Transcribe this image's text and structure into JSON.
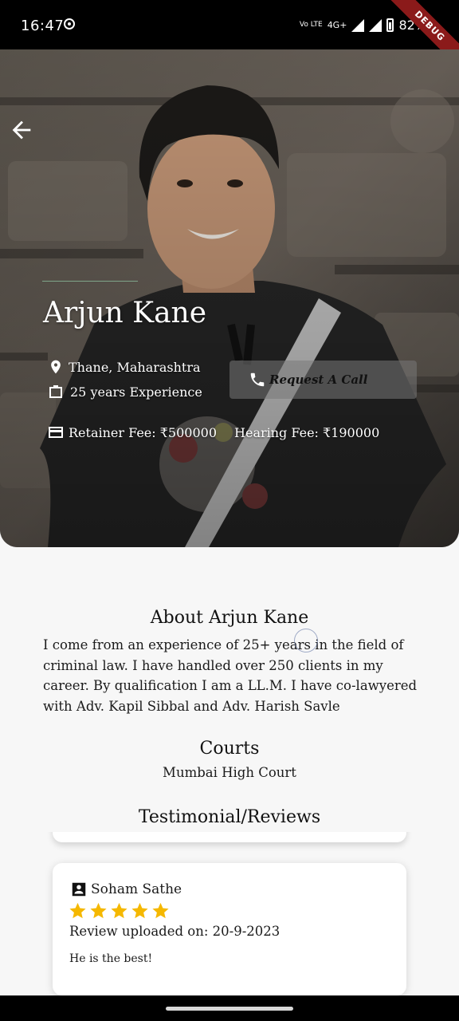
{
  "status_bar": {
    "time": "16:47",
    "network": "Vo LTE",
    "network_type": "4G+",
    "battery": "82%",
    "debug_label": "DEBUG"
  },
  "profile": {
    "name": "Arjun Kane",
    "location": "Thane, Maharashtra",
    "experience": "25 years Experience",
    "retainer_fee": "Retainer Fee: ₹500000",
    "hearing_fee": "Hearing Fee: ₹190000",
    "request_call_label": "Request A Call"
  },
  "about": {
    "title": "About Arjun Kane",
    "text": "I come from an experience of 25+ years in the field of criminal law. I have handled over 250 clients in my career. By qualification I am a LL.M. I have co-lawyered with Adv. Kapil Sibbal and Adv. Harish Savle"
  },
  "courts": {
    "title": "Courts",
    "value": "Mumbai High Court"
  },
  "reviews": {
    "title": "Testimonial/Reviews",
    "items": [
      {
        "reviewer": "Soham Sathe",
        "rating": 5,
        "date": "Review uploaded on: 20-9-2023",
        "text": "He is the best!"
      }
    ]
  },
  "colors": {
    "star": "#f5b800",
    "hero_overlay": "#000000"
  }
}
